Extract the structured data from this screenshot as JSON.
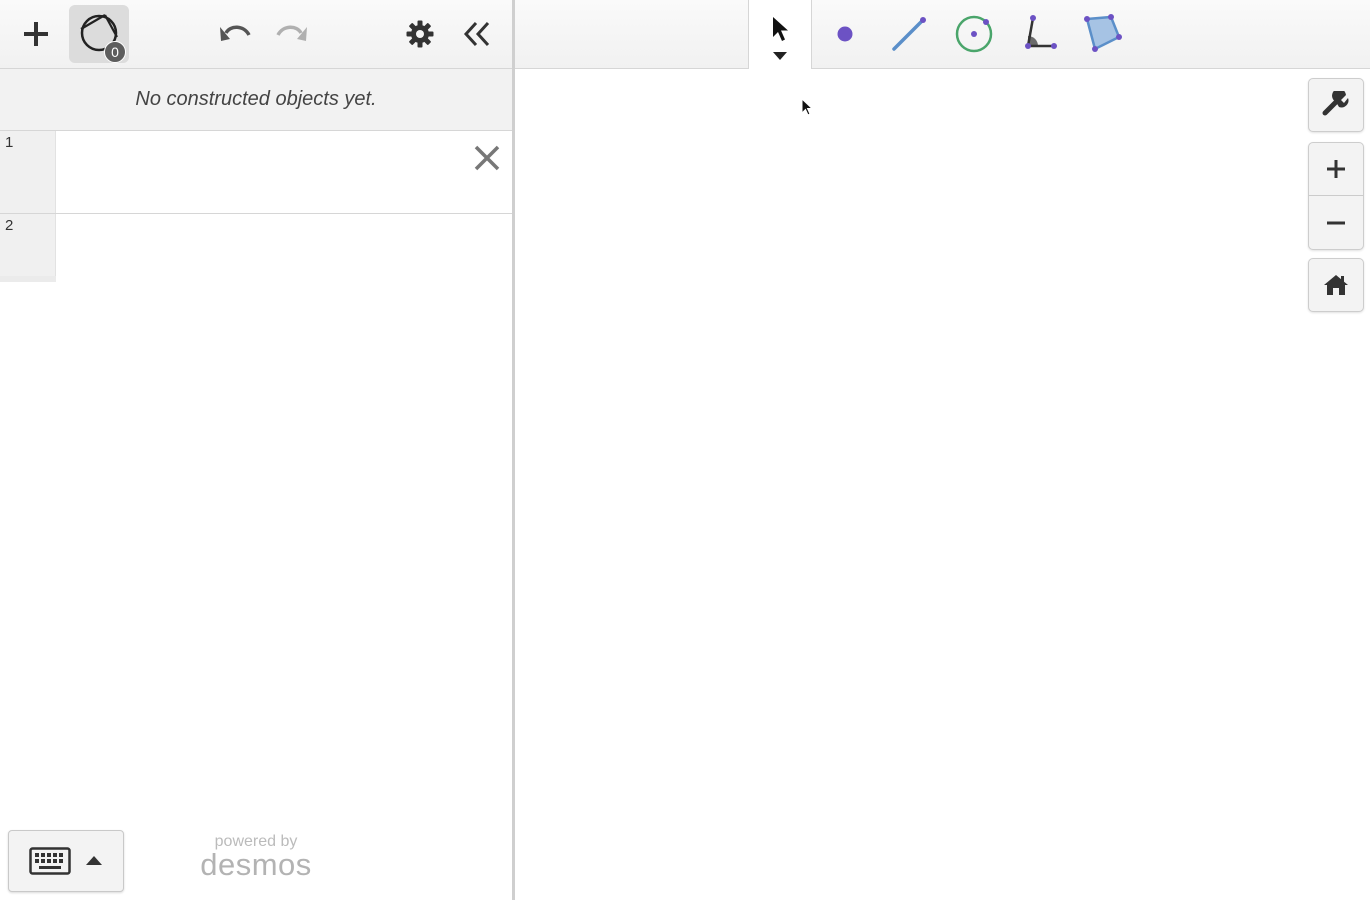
{
  "left_panel": {
    "toolbar": {
      "add_icon": "plus-icon",
      "construction_icon": "construction-circle-icon",
      "construction_count": "0",
      "undo_icon": "undo-icon",
      "redo_icon": "redo-icon",
      "settings_icon": "gear-icon",
      "collapse_icon": "double-chevron-left-icon"
    },
    "empty_message": "No constructed objects yet.",
    "expressions": [
      {
        "index": "1",
        "value": ""
      },
      {
        "index": "2",
        "value": ""
      }
    ],
    "delete_icon": "close-icon",
    "keyboard_icon": "keyboard-icon",
    "keyboard_toggle_icon": "triangle-up-icon",
    "powered_by": "powered by",
    "brand": "desmos"
  },
  "tool_bar": {
    "tools": [
      {
        "name": "select",
        "icon": "pointer-arrow-icon",
        "active": true
      },
      {
        "name": "point",
        "icon": "point-icon",
        "color": "#6c52c4"
      },
      {
        "name": "segment",
        "icon": "segment-icon",
        "color": "#5b8fc9"
      },
      {
        "name": "circle",
        "icon": "circle-icon",
        "color": "#4aa56b"
      },
      {
        "name": "angle",
        "icon": "angle-icon",
        "color": "#6a5ab0"
      },
      {
        "name": "polygon",
        "icon": "polygon-icon",
        "color": "#5b8fc9"
      }
    ]
  },
  "canvas": {
    "controls": [
      {
        "name": "graph-settings",
        "icon": "wrench-icon"
      },
      {
        "name": "zoom-in",
        "icon": "plus-icon"
      },
      {
        "name": "zoom-out",
        "icon": "minus-icon"
      },
      {
        "name": "default-viewport",
        "icon": "home-icon"
      }
    ]
  },
  "colors": {
    "point": "#6c52c4",
    "segment": "#5b8fc9",
    "circle": "#4aa56b",
    "panel_bg": "#f2f2f2"
  }
}
